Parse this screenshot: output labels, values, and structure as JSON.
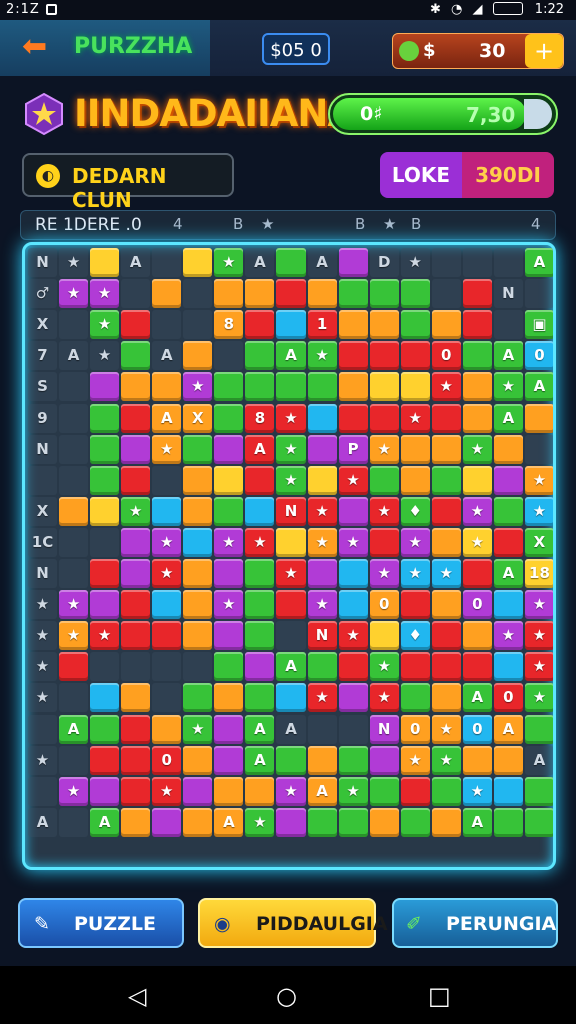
{
  "status_bar": {
    "time_left": "2:1Z",
    "time_right": "1:22"
  },
  "header": {
    "back_label": "PURZZHA",
    "coins": "$05 0",
    "cash_symbol": "$",
    "cash_value": "30",
    "add_label": "+"
  },
  "level": {
    "title": "IINDADAIIANA",
    "progress_left": "0♯",
    "progress_value": "7,30",
    "progress_fraction": 0.87
  },
  "actions": {
    "left_label": "DEDARN CLUN",
    "right_a": "LOKE",
    "right_b": "390DI"
  },
  "info_bar": {
    "label": "RE 1DERE .0",
    "marks": [
      "4",
      "B",
      "★",
      "B",
      "★",
      "B",
      "4"
    ]
  },
  "colors": {
    "red": "#e8262a",
    "green": "#37c338",
    "orange": "#ffa020",
    "yellow": "#ffd12e",
    "blue": "#21b7f0",
    "purple": "#b13bd6",
    "accent_cyan": "#5ce7ff"
  },
  "board": {
    "cols": 16,
    "rows": 19,
    "legend": ".=empty R=red G=green O=orange Y=yellow B=blue P=purple; symbols: s=star a=arrow n=number",
    "cells": [
      ".Y..YG.G.P.....G",
      "PP.O.OOROGGG.R..",
      ".GR..ORBROOGOR.G",
      "..G.O.GGGRRRRGGB",
      ".POOPGGGGOYYROGG",
      ".GROOGRRBRRRROGO",
      ".GPOGPRGPPOOOGO.",
      ".GR.OYRGYRGOGYPO",
      "OYGBOGBRRPRGRPGB",
      "..PPBPRYOPRPOYRG",
      ".RPROPGRPBPBBRGY",
      "PPRBOPGRPBOROPBP",
      "ORRROPG.RRYBROPR",
      "R....GPGGRGRRRBR",
      ".BO.GOGBRPRGOGRG",
      "GGROGPG...POOBOG",
      ".RRROPGGOGPOGOO.",
      "PPRRPOOPOGGRGBBG",
      ".GOPOOGPGGOGOGGG"
    ],
    "labels": [
      [
        "0,0",
        "N"
      ],
      [
        "1,0",
        "★"
      ],
      [
        "3,0",
        "A"
      ],
      [
        "6,0",
        "★"
      ],
      [
        "7,0",
        "A"
      ],
      [
        "9,0",
        "A"
      ],
      [
        "11,0",
        "D"
      ],
      [
        "12,0",
        "★"
      ],
      [
        "16,0",
        "A"
      ],
      [
        "0,1",
        "♂"
      ],
      [
        "1,1",
        "★"
      ],
      [
        "2,1",
        "★"
      ],
      [
        "15,1",
        "N"
      ],
      [
        "0,2",
        "X"
      ],
      [
        "2,2",
        "★"
      ],
      [
        "6,2",
        "8"
      ],
      [
        "9,2",
        "1"
      ],
      [
        "16,2",
        "▣"
      ],
      [
        "0,3",
        "7"
      ],
      [
        "1,3",
        "A"
      ],
      [
        "2,3",
        "★"
      ],
      [
        "4,3",
        "A"
      ],
      [
        "8,3",
        "A"
      ],
      [
        "9,3",
        "★"
      ],
      [
        "13,3",
        "0"
      ],
      [
        "15,3",
        "A"
      ],
      [
        "16,3",
        "0"
      ],
      [
        "0,4",
        "S"
      ],
      [
        "5,4",
        "★"
      ],
      [
        "13,4",
        "★"
      ],
      [
        "15,4",
        "★"
      ],
      [
        "16,4",
        "A"
      ],
      [
        "0,5",
        "9"
      ],
      [
        "4,5",
        "A"
      ],
      [
        "5,5",
        "X"
      ],
      [
        "7,5",
        "8"
      ],
      [
        "8,5",
        "★"
      ],
      [
        "12,5",
        "★"
      ],
      [
        "15,5",
        "A"
      ],
      [
        "0,6",
        "N"
      ],
      [
        "4,6",
        "★"
      ],
      [
        "7,6",
        "A"
      ],
      [
        "8,6",
        "★"
      ],
      [
        "10,6",
        "P"
      ],
      [
        "11,6",
        "★"
      ],
      [
        "14,6",
        "★"
      ],
      [
        "8,7",
        "★"
      ],
      [
        "10,7",
        "★"
      ],
      [
        "16,7",
        "★"
      ],
      [
        "0,8",
        "X"
      ],
      [
        "3,8",
        "★"
      ],
      [
        "8,8",
        "N"
      ],
      [
        "9,8",
        "★"
      ],
      [
        "11,8",
        "★"
      ],
      [
        "12,8",
        "♦"
      ],
      [
        "14,8",
        "★"
      ],
      [
        "16,8",
        "★"
      ],
      [
        "0,9",
        "1C"
      ],
      [
        "4,9",
        "★"
      ],
      [
        "6,9",
        "★"
      ],
      [
        "7,9",
        "★"
      ],
      [
        "9,9",
        "★"
      ],
      [
        "10,9",
        "★"
      ],
      [
        "12,9",
        "★"
      ],
      [
        "14,9",
        "★"
      ],
      [
        "16,9",
        "X"
      ],
      [
        "0,10",
        "N"
      ],
      [
        "4,10",
        "★"
      ],
      [
        "8,10",
        "★"
      ],
      [
        "11,10",
        "★"
      ],
      [
        "12,10",
        "★"
      ],
      [
        "13,10",
        "★"
      ],
      [
        "15,10",
        "A"
      ],
      [
        "16,10",
        "18"
      ],
      [
        "0,11",
        "★"
      ],
      [
        "1,11",
        "★"
      ],
      [
        "6,11",
        "★"
      ],
      [
        "9,11",
        "★"
      ],
      [
        "11,11",
        "0"
      ],
      [
        "14,11",
        "0"
      ],
      [
        "16,11",
        "★"
      ],
      [
        "0,12",
        "★"
      ],
      [
        "1,12",
        "★"
      ],
      [
        "2,12",
        "★"
      ],
      [
        "9,12",
        "N"
      ],
      [
        "10,12",
        "★"
      ],
      [
        "12,12",
        "♦"
      ],
      [
        "15,12",
        "★"
      ],
      [
        "16,12",
        "★"
      ],
      [
        "0,13",
        "★"
      ],
      [
        "8,13",
        "A"
      ],
      [
        "11,13",
        "★"
      ],
      [
        "16,13",
        "★"
      ],
      [
        "0,14",
        "★"
      ],
      [
        "9,14",
        "★"
      ],
      [
        "11,14",
        "★"
      ],
      [
        "14,14",
        "A"
      ],
      [
        "15,14",
        "0"
      ],
      [
        "16,14",
        "★"
      ],
      [
        "1,15",
        "A"
      ],
      [
        "5,15",
        "★"
      ],
      [
        "7,15",
        "A"
      ],
      [
        "8,15",
        "A"
      ],
      [
        "11,15",
        "N"
      ],
      [
        "12,15",
        "0"
      ],
      [
        "13,15",
        "★"
      ],
      [
        "14,15",
        "0"
      ],
      [
        "15,15",
        "A"
      ],
      [
        "0,16",
        "★"
      ],
      [
        "4,16",
        "0"
      ],
      [
        "7,16",
        "A"
      ],
      [
        "12,16",
        "★"
      ],
      [
        "13,16",
        "★"
      ],
      [
        "16,16",
        "A"
      ],
      [
        "1,17",
        "★"
      ],
      [
        "4,17",
        "★"
      ],
      [
        "8,17",
        "★"
      ],
      [
        "9,17",
        "A"
      ],
      [
        "10,17",
        "★"
      ],
      [
        "14,17",
        "★"
      ],
      [
        "0,18",
        "A"
      ],
      [
        "2,18",
        "A"
      ],
      [
        "6,18",
        "A"
      ],
      [
        "7,18",
        "★"
      ],
      [
        "14,18",
        "A"
      ],
      [
        "0,19",
        "★"
      ],
      [
        "4,19",
        "★"
      ],
      [
        "5,19",
        "★"
      ],
      [
        "6,19",
        "★"
      ],
      [
        "7,19",
        "★"
      ],
      [
        "15,19",
        "★"
      ],
      [
        "16,19",
        "★"
      ]
    ]
  },
  "bottom_buttons": [
    {
      "label": "PUZZLE"
    },
    {
      "label": "PIDDAULGIA"
    },
    {
      "label": "PERUNGIA"
    }
  ],
  "nav": {
    "back": "◁",
    "home": "○",
    "recent": "□"
  }
}
